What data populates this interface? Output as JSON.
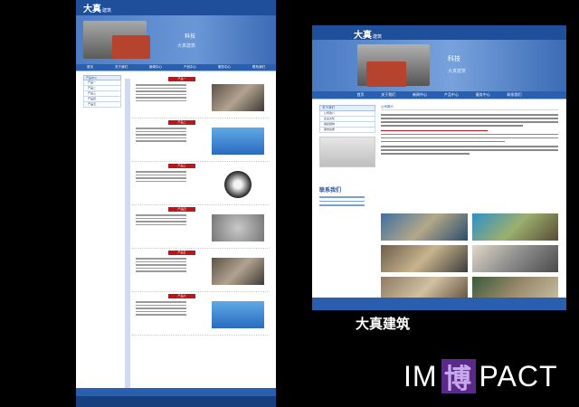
{
  "left_mockup": {
    "logo_main": "大真",
    "logo_sub": "建筑",
    "banner_title": "科技",
    "banner_sub": "大真建筑",
    "nav": [
      "首页",
      "关于我们",
      "新闻中心",
      "产品中心",
      "服务中心",
      "联系我们"
    ],
    "sidebar_header": "产品中心",
    "sidebar_items": [
      "产品一",
      "产品二",
      "产品三",
      "产品四",
      "产品五"
    ],
    "sections": [
      "产品一",
      "产品二",
      "产品三",
      "产品四",
      "产品五",
      "产品六"
    ]
  },
  "right_mockup": {
    "logo_main": "大真",
    "logo_sub": "建筑",
    "banner_title": "科技",
    "banner_sub": "大真建筑",
    "nav": [
      "首页",
      "关于我们",
      "新闻中心",
      "产品中心",
      "服务中心",
      "联系我们"
    ],
    "breadcrumb": "公司简介",
    "sidebar_header": "关于我们",
    "sidebar_items": [
      "公司简介",
      "企业文化",
      "组织结构",
      "荣誉资质"
    ],
    "contact_title": "联系我们"
  },
  "caption": "大真建筑",
  "brand": {
    "prefix": "IM",
    "glyph": "博",
    "suffix": "PACT"
  }
}
